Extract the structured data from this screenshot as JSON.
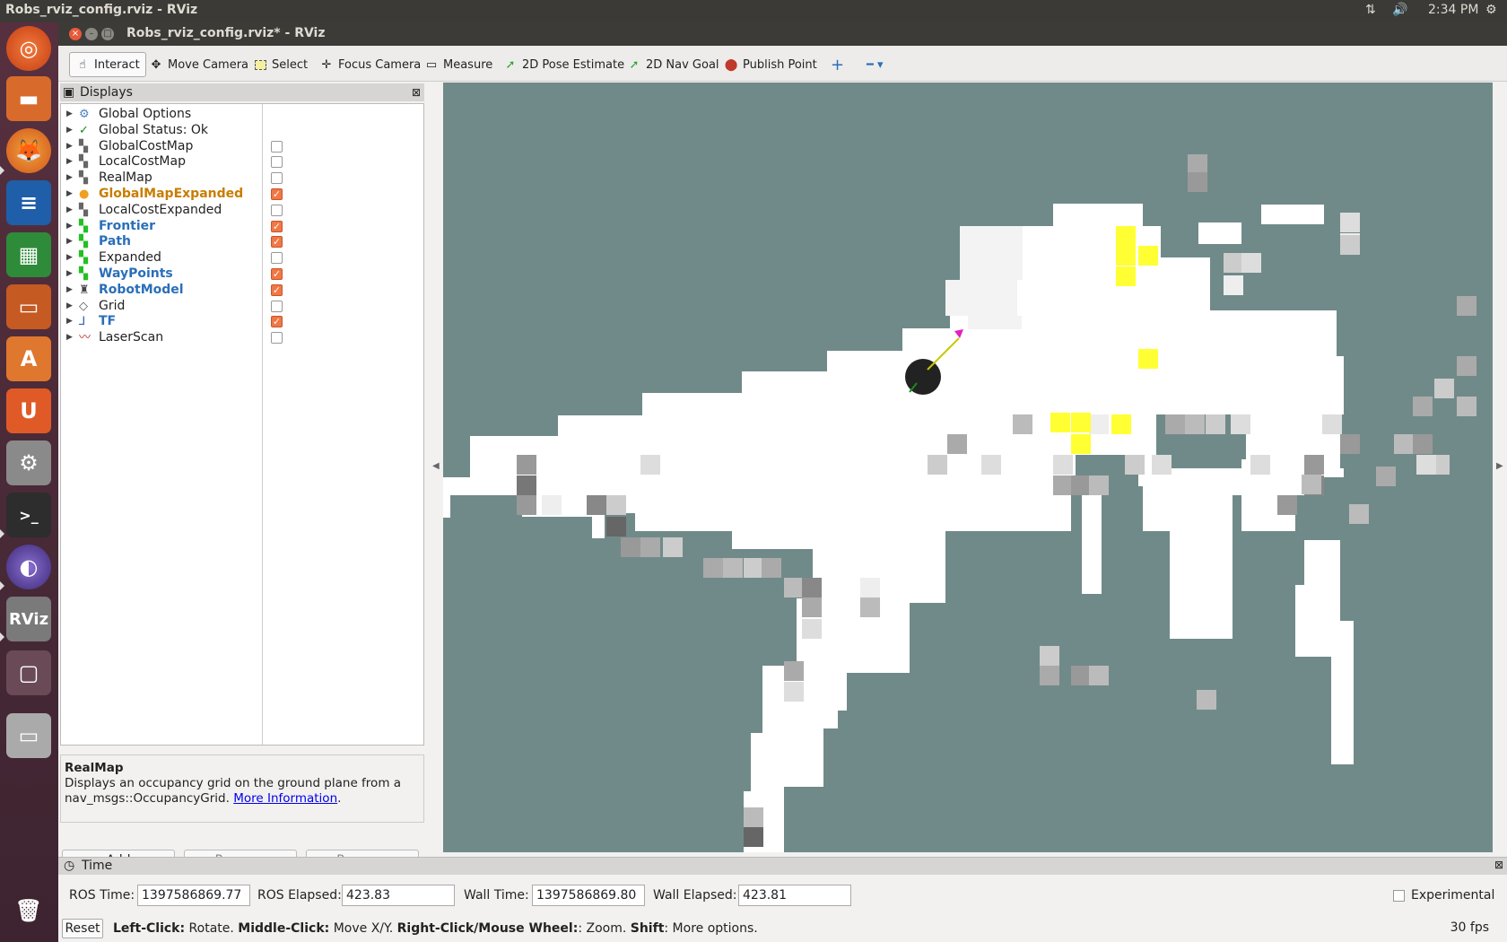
{
  "topbar": {
    "title": "Robs_rviz_config.rviz - RViz",
    "time": "2:34 PM"
  },
  "window": {
    "title": "Robs_rviz_config.rviz* - RViz"
  },
  "toolbar": {
    "interact": "Interact",
    "move_camera": "Move Camera",
    "select": "Select",
    "focus_camera": "Focus Camera",
    "measure": "Measure",
    "pose_estimate": "2D Pose Estimate",
    "nav_goal": "2D Nav Goal",
    "publish_point": "Publish Point"
  },
  "displays": {
    "title": "Displays",
    "items": [
      {
        "label": "Global Options",
        "checked": null,
        "style": "normal",
        "icon": "gear-icon"
      },
      {
        "label": "Global Status: Ok",
        "checked": null,
        "style": "normal",
        "icon": "check-icon"
      },
      {
        "label": "GlobalCostMap",
        "checked": false,
        "style": "normal",
        "icon": "map-icon"
      },
      {
        "label": "LocalCostMap",
        "checked": false,
        "style": "normal",
        "icon": "map-icon"
      },
      {
        "label": "RealMap",
        "checked": false,
        "style": "normal",
        "icon": "map-icon"
      },
      {
        "label": "GlobalMapExpanded",
        "checked": true,
        "style": "warn",
        "icon": "warning-icon"
      },
      {
        "label": "LocalCostExpanded",
        "checked": false,
        "style": "normal",
        "icon": "map-icon"
      },
      {
        "label": "Frontier",
        "checked": true,
        "style": "active",
        "icon": "marker-icon"
      },
      {
        "label": "Path",
        "checked": true,
        "style": "active",
        "icon": "marker-icon"
      },
      {
        "label": "Expanded",
        "checked": false,
        "style": "normal",
        "icon": "marker-icon"
      },
      {
        "label": "WayPoints",
        "checked": true,
        "style": "active",
        "icon": "marker-icon"
      },
      {
        "label": "RobotModel",
        "checked": true,
        "style": "active",
        "icon": "robot-icon"
      },
      {
        "label": "Grid",
        "checked": false,
        "style": "normal",
        "icon": "grid-icon"
      },
      {
        "label": "TF",
        "checked": true,
        "style": "active",
        "icon": "axes-icon"
      },
      {
        "label": "LaserScan",
        "checked": false,
        "style": "normal",
        "icon": "laser-icon"
      }
    ]
  },
  "description": {
    "title": "RealMap",
    "text": "Displays an occupancy grid on the ground plane from a nav_msgs::OccupancyGrid.",
    "link": "More Information",
    "tail": "."
  },
  "buttons": {
    "add": "Add",
    "remove": "Remove",
    "rename": "Rename"
  },
  "time": {
    "title": "Time",
    "ros_time_label": "ROS Time:",
    "ros_time": "1397586869.77",
    "ros_elapsed_label": "ROS Elapsed:",
    "ros_elapsed": "423.83",
    "wall_time_label": "Wall Time:",
    "wall_time": "1397586869.80",
    "wall_elapsed_label": "Wall Elapsed:",
    "wall_elapsed": "423.81",
    "experimental": "Experimental"
  },
  "status": {
    "reset": "Reset",
    "k1": "Left-Click:",
    "t1": " Rotate. ",
    "k2": "Middle-Click:",
    "t2": " Move X/Y. ",
    "k3": "Right-Click/Mouse Wheel:",
    "t3": ": Zoom. ",
    "k4": "Shift",
    "t4": ": More options.",
    "fps": "30 fps"
  },
  "colors": {
    "map_bg": "#708a89",
    "free": "#ffffff",
    "frontier": "#ffff33",
    "warn": "#c87d00",
    "active": "#2a6fb8"
  }
}
